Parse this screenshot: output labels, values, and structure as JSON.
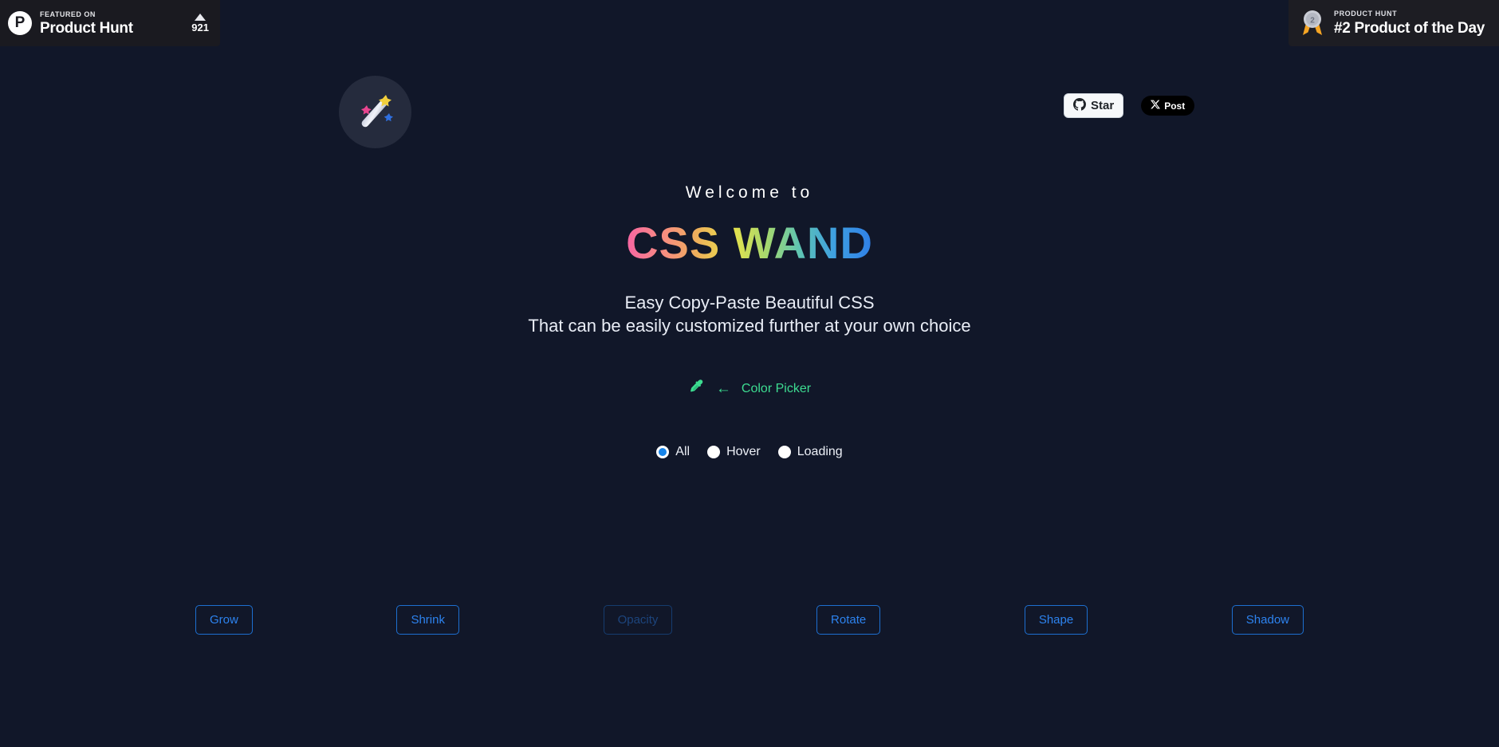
{
  "product_hunt_banner": {
    "logo_letter": "P",
    "featured_label": "FEATURED ON",
    "site_name": "Product Hunt",
    "upvote_count": "921"
  },
  "product_of_day_badge": {
    "kicker": "PRODUCT HUNT",
    "title": "#2 Product of the Day",
    "medal_rank": "2"
  },
  "social": {
    "github_star_label": "Star",
    "x_post_label": "Post"
  },
  "hero": {
    "welcome": "Welcome to",
    "brand": "CSS WAND",
    "tagline_line1": "Easy Copy-Paste Beautiful CSS",
    "tagline_line2": "That can be easily customized further at your own choice"
  },
  "color_picker": {
    "arrow": "←",
    "label": "Color Picker",
    "accent": "#3ddc91"
  },
  "filters": {
    "options": [
      {
        "label": "All",
        "checked": true
      },
      {
        "label": "Hover",
        "checked": false
      },
      {
        "label": "Loading",
        "checked": false
      }
    ]
  },
  "demo_buttons": [
    {
      "label": "Grow",
      "dim": false
    },
    {
      "label": "Shrink",
      "dim": false
    },
    {
      "label": "Opacity",
      "dim": true
    },
    {
      "label": "Rotate",
      "dim": false
    },
    {
      "label": "Shape",
      "dim": false
    },
    {
      "label": "Shadow",
      "dim": false
    }
  ],
  "theme": {
    "background": "#111729",
    "button_border": "#1d6fd0",
    "button_text": "#2d83ef",
    "radio_checked": "#1683e8"
  }
}
